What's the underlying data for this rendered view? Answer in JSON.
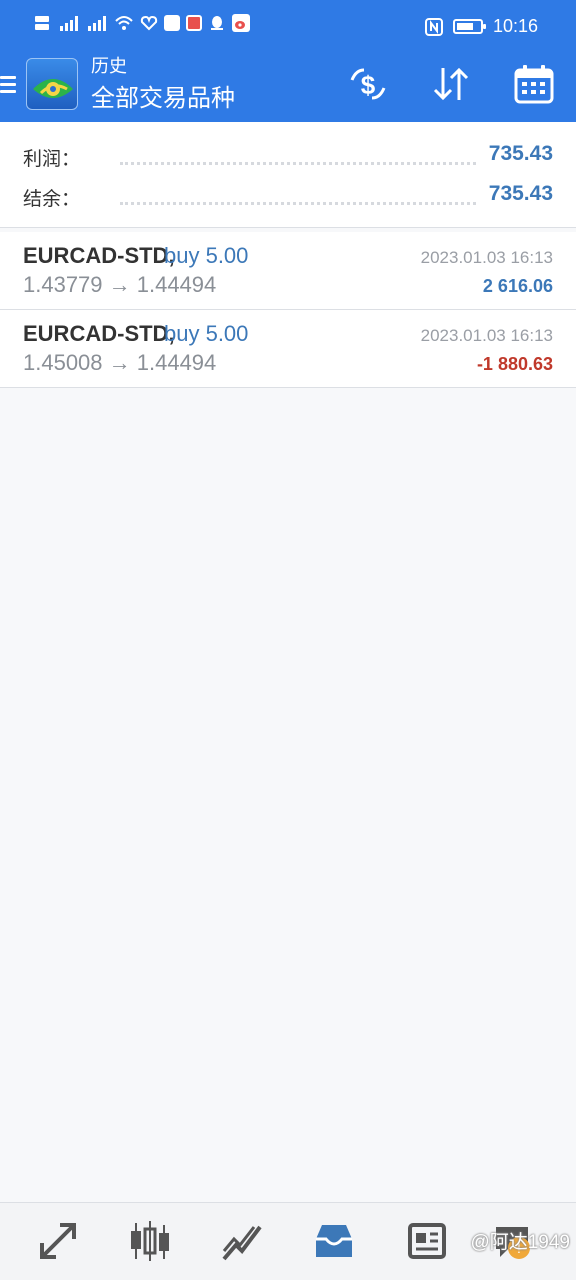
{
  "status_bar": {
    "time": "10:16",
    "battery_level": 0.75,
    "left_icons": [
      "hd-icon",
      "signal-4g-icon",
      "signal-5g-icon",
      "wifi-icon",
      "heart-icon",
      "upload-icon",
      "book-app-icon",
      "qq-icon",
      "weibo-icon"
    ],
    "right_icons": [
      "nfc-icon",
      "battery-icon"
    ]
  },
  "header": {
    "subtitle": "历史",
    "title": "全部交易品种",
    "color": "#2f7ae5"
  },
  "summary": {
    "profit_label": "利润：",
    "profit_value": "735.43",
    "balance_label": "结余：",
    "balance_value": "735.43"
  },
  "trades": [
    {
      "symbol": "EURCAD-STD,",
      "side": "buy 5.00",
      "prices": "1.43779 → 1.44494",
      "datetime": "2023.01.03 16:13",
      "pl": "2 616.06",
      "pl_color": "#3c78b8"
    },
    {
      "symbol": "EURCAD-STD,",
      "side": "buy 5.00",
      "prices": "1.45008 → 1.44494",
      "datetime": "2023.01.03 16:13",
      "pl": "-1 880.63",
      "pl_color": "#c0392b"
    }
  ],
  "bottom_nav": {
    "items": [
      "quotes-icon",
      "chart-icon",
      "trade-icon",
      "history-icon",
      "news-icon",
      "chat-icon"
    ],
    "active": "history-icon",
    "watermark": "@阿达1949"
  }
}
